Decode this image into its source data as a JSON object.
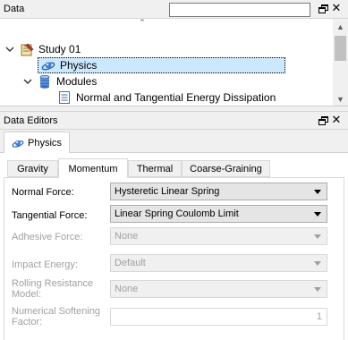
{
  "data_panel": {
    "title": "Data",
    "filter_value": "",
    "tree": [
      {
        "label": "Study 01",
        "icon": "study-icon",
        "expanded": true
      },
      {
        "label": "Physics",
        "icon": "physics-icon",
        "selected": true
      },
      {
        "label": "Modules",
        "icon": "database-icon",
        "expanded": true
      },
      {
        "label": "Normal and Tangential Energy Dissipation",
        "icon": "document-icon"
      }
    ]
  },
  "editors_panel": {
    "title": "Data Editors",
    "doc_tab": "Physics",
    "tabs": [
      "Gravity",
      "Momentum",
      "Thermal",
      "Coarse-Graining"
    ],
    "active_tab": "Momentum",
    "properties": {
      "normal_force": {
        "label": "Normal Force:",
        "value": "Hysteretic Linear Spring",
        "enabled": true
      },
      "tangential_force": {
        "label": "Tangential Force:",
        "value": "Linear Spring Coulomb Limit",
        "enabled": true
      },
      "adhesive_force": {
        "label": "Adhesive Force:",
        "value": "None",
        "enabled": false
      },
      "impact_energy": {
        "label": "Impact Energy:",
        "value": "Default",
        "enabled": false
      },
      "rolling_resistance": {
        "label": "Rolling Resistance Model:",
        "value": "None",
        "enabled": false
      },
      "softening_factor": {
        "label": "Numerical Softening Factor:",
        "value": "1",
        "enabled": false
      }
    }
  }
}
